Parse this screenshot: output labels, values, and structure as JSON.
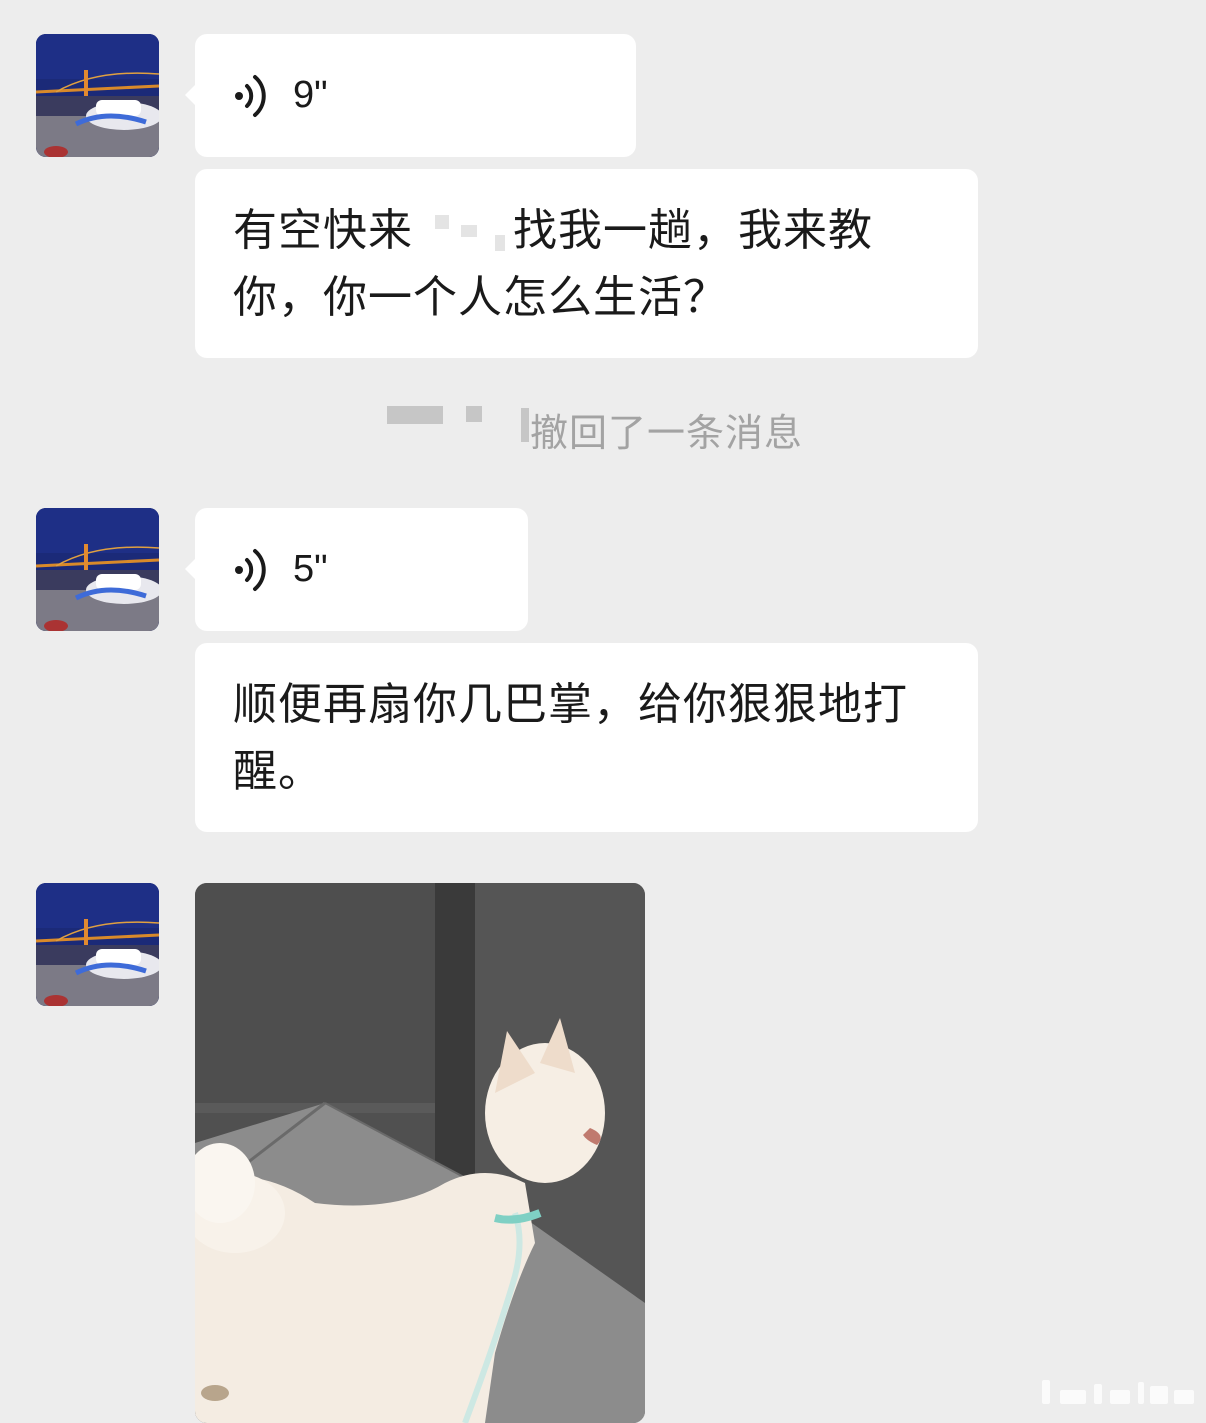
{
  "chat": {
    "messages": [
      {
        "type": "voice",
        "duration": "9\""
      },
      {
        "type": "text",
        "text_part1": "有空快来",
        "text_part2": "找我一趟，我来教你，你一个人怎么生活？"
      },
      {
        "type": "system",
        "text": "撤回了一条消息"
      },
      {
        "type": "voice",
        "duration": "5\""
      },
      {
        "type": "text",
        "text": "顺便再扇你几巴掌，给你狠狠地打醒。"
      },
      {
        "type": "image",
        "subject": "white-dog-in-elevator"
      }
    ]
  },
  "colors": {
    "background": "#ededed",
    "bubble": "#ffffff",
    "text": "#1a1a1a",
    "system_text": "#a3a3a3"
  }
}
